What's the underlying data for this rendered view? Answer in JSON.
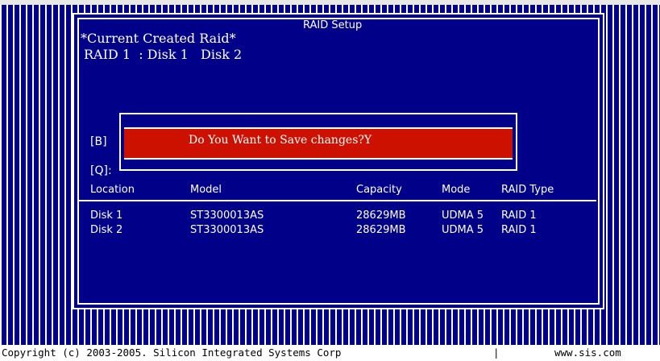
{
  "dialog": {
    "title": "RAID Setup",
    "current_raid_title": "*Current Created Raid*",
    "current_raid_line": "RAID 1  : Disk 1   Disk 2"
  },
  "options": {
    "b_label": "[B]",
    "q_label": "[Q]:"
  },
  "confirm": {
    "prompt": "Do You Want to Save changes?Y"
  },
  "table": {
    "headers": {
      "location": "Location",
      "model": "Model",
      "capacity": "Capacity",
      "mode": "Mode",
      "raid_type": "RAID Type"
    },
    "rows": [
      {
        "location": "Disk 1",
        "model": "ST3300013AS",
        "capacity": "28629MB",
        "mode": "UDMA 5",
        "raid_type": "RAID 1"
      },
      {
        "location": "Disk 2",
        "model": "ST3300013AS",
        "capacity": "28629MB",
        "mode": "UDMA 5",
        "raid_type": "RAID 1"
      }
    ]
  },
  "status_bar": {
    "copyright": "Copyright (c) 2003-2005. Silicon Integrated Systems Corp",
    "divider": "|",
    "url": "www.sis.com"
  },
  "colors": {
    "screen_bg": "#000088",
    "stripe": "#ffffff",
    "confirm_band": "#cc1100",
    "text": "#ffffff",
    "status_bg": "#ffffff"
  }
}
